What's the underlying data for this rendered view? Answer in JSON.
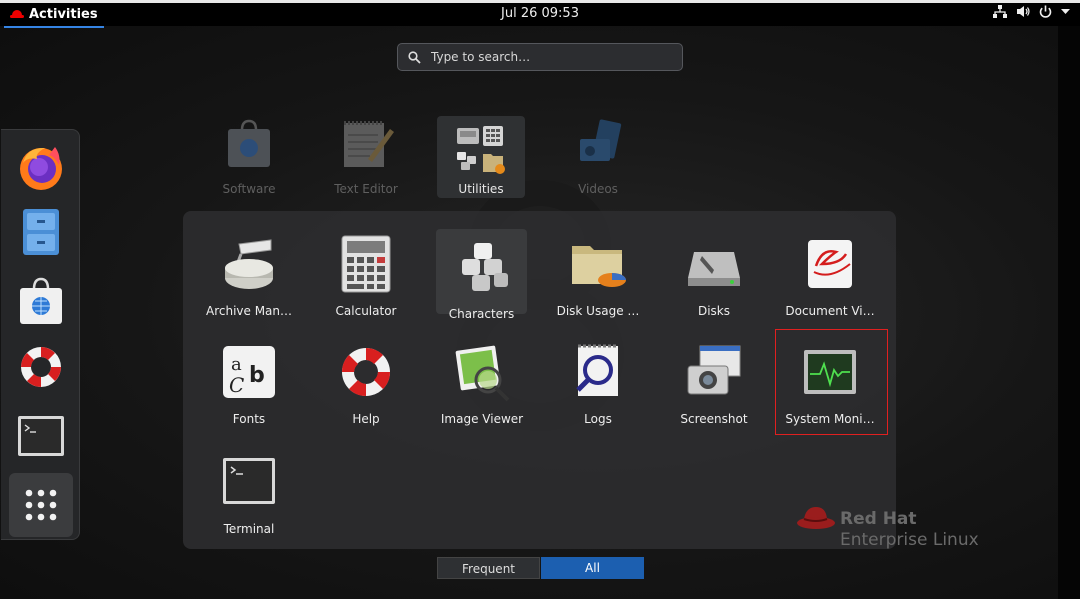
{
  "topbar": {
    "activities": "Activities",
    "datetime": "Jul 26  09:53"
  },
  "search": {
    "placeholder": "Type to search…"
  },
  "favorites": [
    {
      "label": "Software"
    },
    {
      "label": "Text Editor"
    },
    {
      "label": "Utilities"
    },
    {
      "label": "Videos"
    }
  ],
  "apps": [
    {
      "label": "Archive Man…"
    },
    {
      "label": "Calculator"
    },
    {
      "label": "Characters"
    },
    {
      "label": "Disk Usage …"
    },
    {
      "label": "Disks"
    },
    {
      "label": "Document Vi…"
    },
    {
      "label": "Fonts"
    },
    {
      "label": "Help"
    },
    {
      "label": "Image Viewer"
    },
    {
      "label": "Logs"
    },
    {
      "label": "Screenshot"
    },
    {
      "label": "System Moni…"
    },
    {
      "label": "Terminal"
    }
  ],
  "view_toggle": {
    "frequent": "Frequent",
    "all": "All",
    "selected": "All"
  },
  "watermark": {
    "line1": "Red Hat",
    "line2": "Enterprise Linux"
  },
  "colors": {
    "accent": "#1c5fb0",
    "highlight": "#e02020",
    "brand": "#ee0000"
  }
}
